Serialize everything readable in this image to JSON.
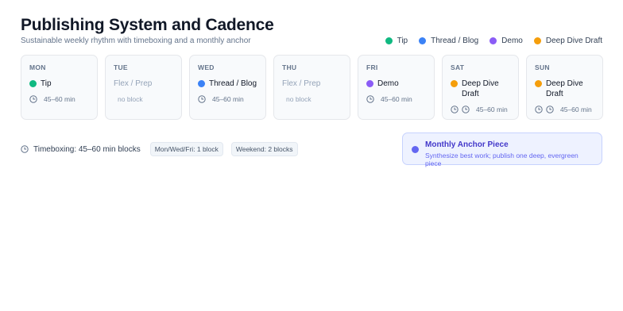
{
  "header": {
    "title": "Publishing System and Cadence",
    "subtitle": "Sustainable weekly rhythm with timeboxing and a monthly anchor"
  },
  "legend": [
    {
      "label": "Tip",
      "color": "#10b981"
    },
    {
      "label": "Thread / Blog",
      "color": "#3b82f6"
    },
    {
      "label": "Demo",
      "color": "#8b5cf6"
    },
    {
      "label": "Deep Dive Draft",
      "color": "#f59e0b"
    }
  ],
  "days": [
    {
      "name": "MON",
      "task": "Tip",
      "color": "#10b981",
      "meta": "45–60 min",
      "clocks": 1
    },
    {
      "name": "TUE",
      "task": "Flex / Prep",
      "color": "",
      "meta": "no block",
      "clocks": 0
    },
    {
      "name": "WED",
      "task": "Thread / Blog",
      "color": "#3b82f6",
      "meta": "45–60 min",
      "clocks": 1
    },
    {
      "name": "THU",
      "task": "Flex / Prep",
      "color": "",
      "meta": "no block",
      "clocks": 0
    },
    {
      "name": "FRI",
      "task": "Demo",
      "color": "#8b5cf6",
      "meta": "45–60 min",
      "clocks": 1
    },
    {
      "name": "SAT",
      "task": "Deep Dive Draft",
      "color": "#f59e0b",
      "meta": "45–60 min",
      "clocks": 2
    },
    {
      "name": "SUN",
      "task": "Deep Dive Draft",
      "color": "#f59e0b",
      "meta": "45–60 min",
      "clocks": 2
    }
  ],
  "timeboxing": {
    "label": "Timeboxing: 45–60 min blocks",
    "chips": [
      "Mon/Wed/Fri: 1 block",
      "Weekend: 2 blocks"
    ]
  },
  "anchor": {
    "title": "Monthly Anchor Piece",
    "subtitle": "Synthesize best work; publish one deep, evergreen piece",
    "color": "#6366f1"
  },
  "icons": {
    "clock": "clock-icon"
  }
}
